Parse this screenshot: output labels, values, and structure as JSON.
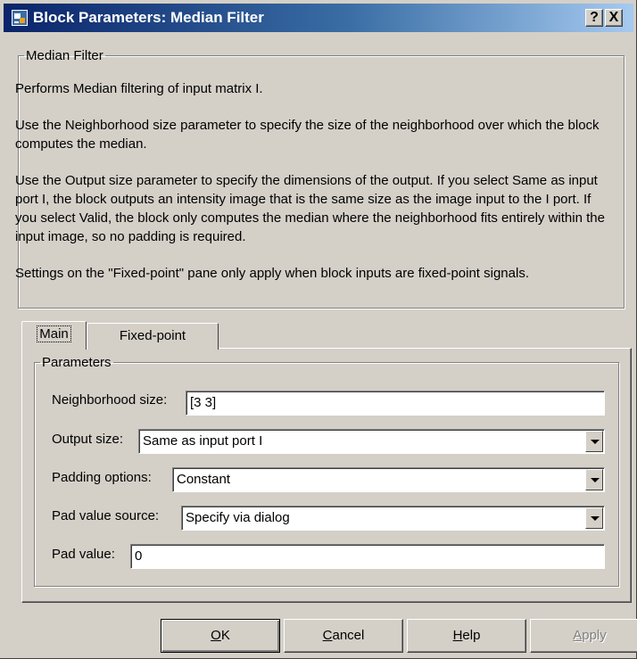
{
  "window": {
    "title": "Block Parameters: Median Filter",
    "help_glyph": "?",
    "close_glyph": "X",
    "icon": "simulink-block-icon"
  },
  "description": {
    "legend": "Median Filter",
    "paragraphs": [
      "Performs Median filtering of input matrix I.",
      "Use the Neighborhood size parameter to specify the size of the neighborhood over which the block computes the median.",
      "Use the Output size parameter to specify the dimensions of the output. If you select Same as input port I, the block outputs an intensity image that is the same size as the image input to the I port. If you select Valid, the block only computes the median where the neighborhood fits entirely within the input image, so no padding is required.",
      "Settings on the \"Fixed-point\" pane only apply when block inputs are fixed-point signals."
    ]
  },
  "tabs": [
    {
      "label": "Main",
      "active": true
    },
    {
      "label": "Fixed-point",
      "active": false
    }
  ],
  "parameters": {
    "legend": "Parameters",
    "neighborhood_size": {
      "label": "Neighborhood size:",
      "value": "[3 3]"
    },
    "output_size": {
      "label": "Output size:",
      "value": "Same as input port I"
    },
    "padding_options": {
      "label": "Padding options:",
      "value": "Constant"
    },
    "pad_value_source": {
      "label": "Pad value source:",
      "value": "Specify via dialog"
    },
    "pad_value": {
      "label": "Pad value:",
      "value": "0"
    }
  },
  "buttons": {
    "ok": {
      "mnemonic": "O",
      "rest": "K"
    },
    "cancel": {
      "mnemonic": "C",
      "rest": "ancel"
    },
    "help": {
      "mnemonic": "H",
      "rest": "elp"
    },
    "apply": {
      "mnemonic": "A",
      "rest": "pply",
      "enabled": false
    }
  },
  "colors": {
    "titlebar_start": "#0a246a",
    "titlebar_end": "#a6caf0",
    "face": "#d4d0c8"
  }
}
